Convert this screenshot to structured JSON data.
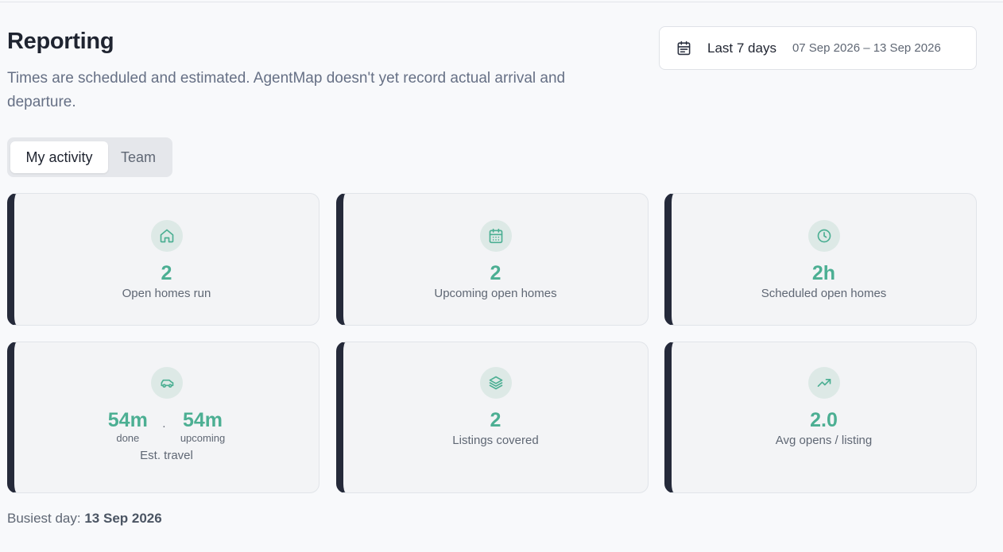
{
  "header": {
    "title": "Reporting",
    "subtitle": "Times are scheduled and estimated. AgentMap doesn't yet record actual arrival and departure."
  },
  "date_range": {
    "label": "Last 7 days",
    "dates": "07 Sep 2026 – 13 Sep 2026",
    "icon": "calendar-icon"
  },
  "tabs": {
    "my_activity": "My activity",
    "team": "Team",
    "selected": "my_activity"
  },
  "cards": {
    "open_homes_run": {
      "icon": "home-icon",
      "value": "2",
      "label": "Open homes run"
    },
    "upcoming_open_homes": {
      "icon": "calendar-icon",
      "value": "2",
      "label": "Upcoming open homes"
    },
    "scheduled_open_homes": {
      "icon": "clock-icon",
      "value": "2h",
      "label": "Scheduled open homes"
    },
    "est_travel": {
      "icon": "car-icon",
      "done_value": "54m",
      "done_label": "done",
      "separator": "·",
      "upcoming_value": "54m",
      "upcoming_label": "upcoming",
      "label": "Est. travel"
    },
    "listings_covered": {
      "icon": "layers-icon",
      "value": "2",
      "label": "Listings covered"
    },
    "avg_opens": {
      "icon": "trending-up-icon",
      "value": "2.0",
      "label": "Avg opens / listing"
    }
  },
  "busiest": {
    "prefix": "Busiest day:",
    "value": "13 Sep 2026"
  },
  "colors": {
    "accent": "#4caf93",
    "card_border_left": "#252a3a",
    "icon_bg": "#dde9e6"
  }
}
